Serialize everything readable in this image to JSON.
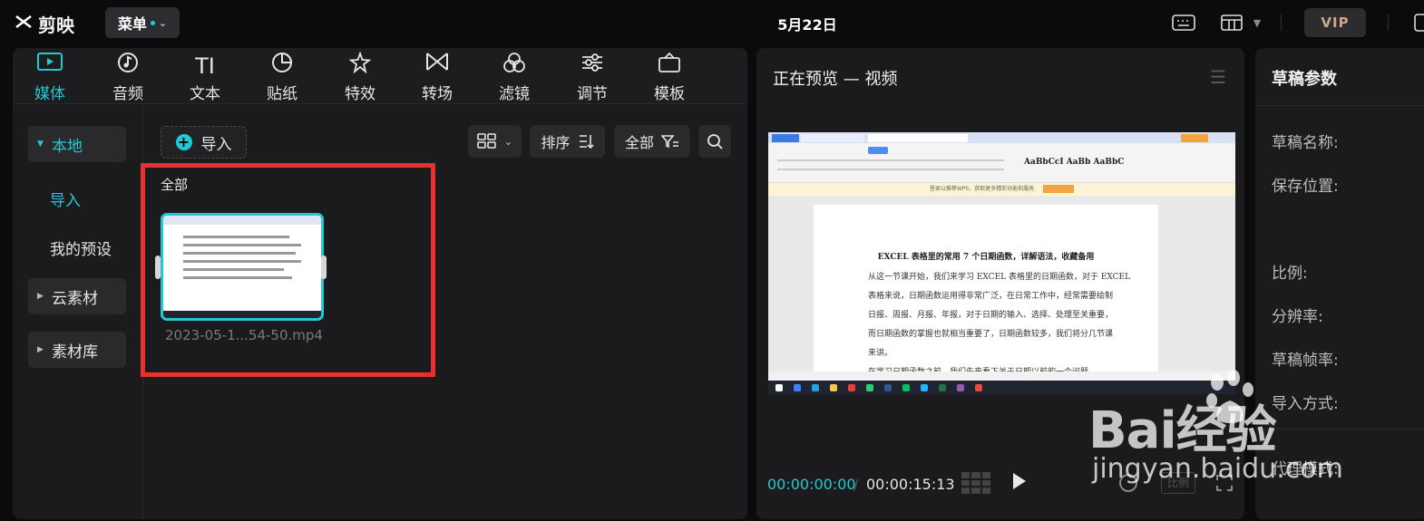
{
  "app": {
    "logo": "剪映",
    "menu_label": "菜单",
    "title": "5月22日",
    "vip": "VIP"
  },
  "tabs": [
    {
      "label": "媒体",
      "icon": "media-icon"
    },
    {
      "label": "音频",
      "icon": "audio-icon"
    },
    {
      "label": "文本",
      "icon": "text-icon"
    },
    {
      "label": "贴纸",
      "icon": "sticker-icon"
    },
    {
      "label": "特效",
      "icon": "effects-icon"
    },
    {
      "label": "转场",
      "icon": "transition-icon"
    },
    {
      "label": "滤镜",
      "icon": "filter-icon"
    },
    {
      "label": "调节",
      "icon": "adjust-icon"
    },
    {
      "label": "模板",
      "icon": "template-icon"
    }
  ],
  "sidebar": {
    "local": "本地",
    "import": "导入",
    "my_presets": "我的预设",
    "cloud": "云素材",
    "library": "素材库"
  },
  "media": {
    "import_button": "导入",
    "sort": "排序",
    "filter": "全部",
    "group_label": "全部",
    "clip_name": "2023-05-1...54-50.mp4"
  },
  "preview": {
    "title": "正在预览 — 视频",
    "time_current": "00:00:00:00",
    "time_total": "00:00:15:13",
    "ratio": "比例",
    "doc_title": "EXCEL 表格里的常用 7 个日期函数，详解语法，收藏备用",
    "doc_lines": [
      "从这一节课开始，我们来学习 EXCEL 表格里的日期函数，对于 EXCEL",
      "表格来说，日期函数运用得非常广泛，在日常工作中，经常需要绘制",
      "日报、周报、月报、年报，对于日期的输入、选择、处理至关重要，",
      "而日期函数的掌握也就相当重要了，日期函数较多，我们将分几节课",
      "来讲。",
      "在学习日期函数之前，我们先来看下关于日期以前的一个问题"
    ],
    "notice": "登录以推荐WPS，获取更多精彩功能和服务"
  },
  "props": {
    "title": "草稿参数",
    "labels": [
      "草稿名称:",
      "保存位置:",
      "比例:",
      "分辨率:",
      "草稿帧率:",
      "导入方式:",
      "代理模式:"
    ]
  },
  "watermark": {
    "main": "Bai经验",
    "sub": "jingyan.baidu.com"
  },
  "colors": {
    "accent": "#25c8d2",
    "highlight_box": "#e8302e"
  }
}
